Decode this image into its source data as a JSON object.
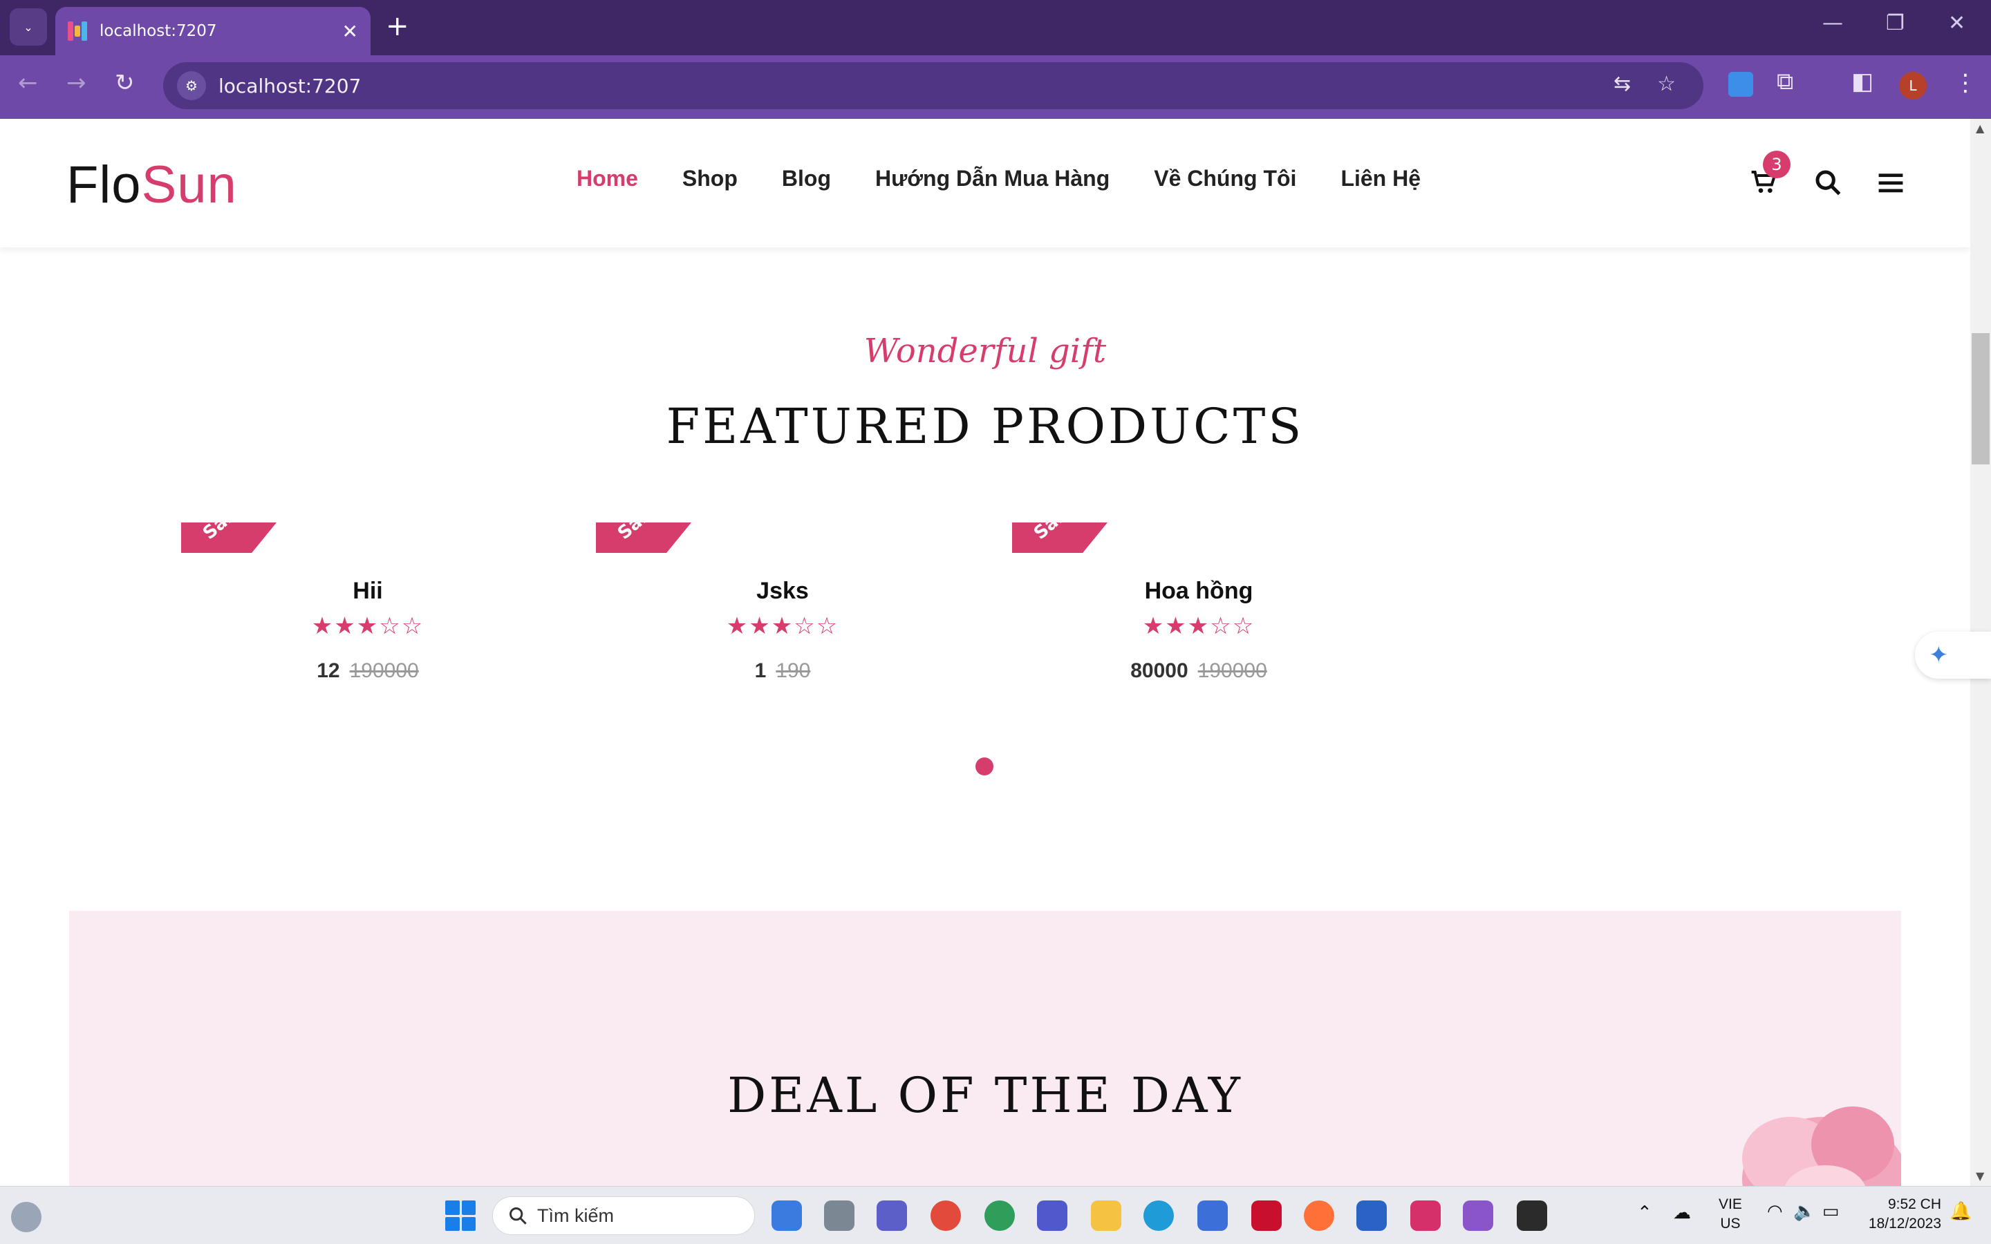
{
  "browser": {
    "tab_title": "localhost:7207",
    "url": "localhost:7207",
    "profile_initial": "L"
  },
  "site": {
    "logo_part1": "Flo",
    "logo_part2": "Sun",
    "nav": [
      "Home",
      "Shop",
      "Blog",
      "Hướng Dẫn Mua Hàng",
      "Về Chúng Tôi",
      "Liên Hệ"
    ],
    "cart_count": "3"
  },
  "featured": {
    "subtitle": "Wonderful gift",
    "title": "FEATURED PRODUCTS",
    "sale_label": "Sale!",
    "products": [
      {
        "name": "Hii",
        "rating": 3,
        "price": "12",
        "old_price": "190000"
      },
      {
        "name": "Jsks",
        "rating": 3,
        "price": "1",
        "old_price": "190"
      },
      {
        "name": "Hoa hồng",
        "rating": 3,
        "price": "80000",
        "old_price": "190000"
      }
    ]
  },
  "deal": {
    "title": "DEAL OF THE DAY"
  },
  "taskbar": {
    "search_placeholder": "Tìm kiếm",
    "lang_line1": "VIE",
    "lang_line2": "US",
    "time": "9:52 CH",
    "date": "18/12/2023"
  },
  "colors": {
    "accent": "#d63d6c",
    "chrome": "#6f49a8",
    "titlebar": "#3f2766"
  }
}
